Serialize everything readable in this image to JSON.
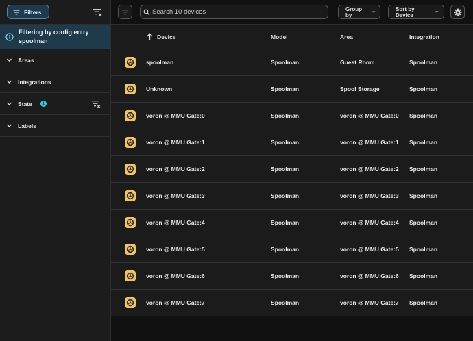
{
  "sidebar": {
    "filters_label": "Filters",
    "info_text": "Filtering by config entry spoolman",
    "sections": [
      {
        "label": "Areas",
        "badge": ""
      },
      {
        "label": "Integrations",
        "badge": ""
      },
      {
        "label": "State",
        "badge": "1"
      },
      {
        "label": "Labels",
        "badge": ""
      }
    ]
  },
  "toolbar": {
    "search_placeholder": "Search 10 devices",
    "group_by_label": "Group by",
    "sort_by_label": "Sort by Device"
  },
  "table": {
    "columns": {
      "device": "Device",
      "model": "Model",
      "area": "Area",
      "integration": "Integration"
    },
    "rows": [
      {
        "device": "spoolman",
        "model": "Spoolman",
        "area": "Guest Room",
        "integration": "Spoolman"
      },
      {
        "device": "Unknown",
        "model": "Spoolman",
        "area": "Spool Storage",
        "integration": "Spoolman"
      },
      {
        "device": "voron @ MMU Gate:0",
        "model": "Spoolman",
        "area": "voron @ MMU Gate:0",
        "integration": "Spoolman"
      },
      {
        "device": "voron @ MMU Gate:1",
        "model": "Spoolman",
        "area": "voron @ MMU Gate:1",
        "integration": "Spoolman"
      },
      {
        "device": "voron @ MMU Gate:2",
        "model": "Spoolman",
        "area": "voron @ MMU Gate:2",
        "integration": "Spoolman"
      },
      {
        "device": "voron @ MMU Gate:3",
        "model": "Spoolman",
        "area": "voron @ MMU Gate:3",
        "integration": "Spoolman"
      },
      {
        "device": "voron @ MMU Gate:4",
        "model": "Spoolman",
        "area": "voron @ MMU Gate:4",
        "integration": "Spoolman"
      },
      {
        "device": "voron @ MMU Gate:5",
        "model": "Spoolman",
        "area": "voron @ MMU Gate:5",
        "integration": "Spoolman"
      },
      {
        "device": "voron @ MMU Gate:6",
        "model": "Spoolman",
        "area": "voron @ MMU Gate:6",
        "integration": "Spoolman"
      },
      {
        "device": "voron @ MMU Gate:7",
        "model": "Spoolman",
        "area": "voron @ MMU Gate:7",
        "integration": "Spoolman"
      }
    ]
  },
  "icons": {
    "filter": "filter-icon",
    "clear_filter": "filter-remove-icon",
    "info": "info-icon",
    "chevron": "chevron-down-icon",
    "search": "search-icon",
    "sort_arrow": "arrow-up-icon",
    "gear": "gear-icon",
    "device": "spool-icon"
  },
  "colors": {
    "accent": "#4a86a8",
    "info_bg": "#1f3a4a",
    "badge": "#2bd0e8",
    "device_icon": "#f2c263"
  }
}
